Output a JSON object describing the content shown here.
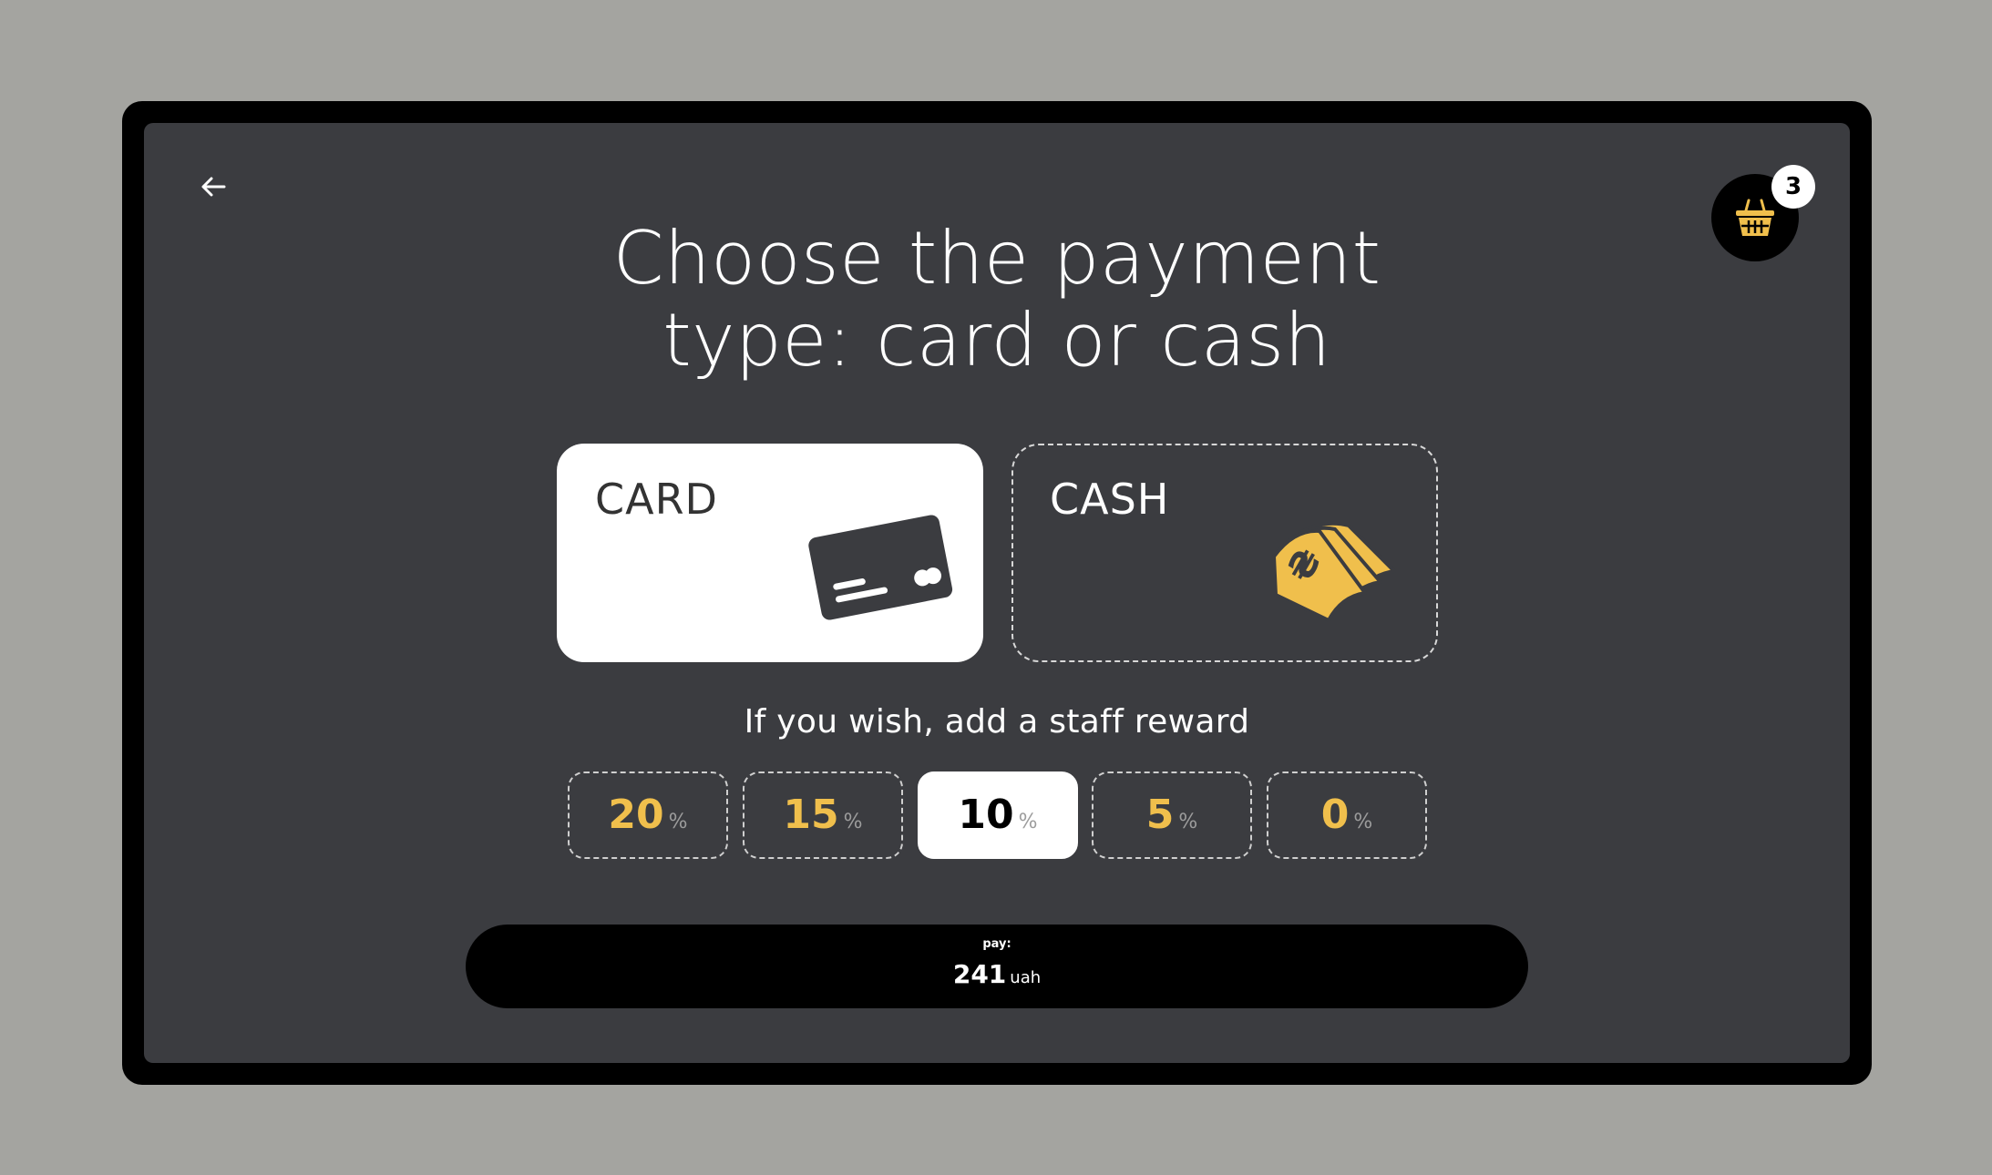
{
  "header": {
    "title_line1": "Choose the payment",
    "title_line2": "type: card or cash",
    "basket_count": "3"
  },
  "payment_options": {
    "card_label": "CARD",
    "cash_label": "CASH",
    "selected": "card"
  },
  "tips": {
    "title": "If you wish, add a staff reward",
    "options": [
      {
        "value": "20",
        "unit": "%"
      },
      {
        "value": "15",
        "unit": "%"
      },
      {
        "value": "10",
        "unit": "%"
      },
      {
        "value": "5",
        "unit": "%"
      },
      {
        "value": "0",
        "unit": "%"
      }
    ],
    "selected_value": "10"
  },
  "pay_bar": {
    "label": "pay:",
    "amount": "241",
    "currency": "uah"
  },
  "colors": {
    "accent": "#f0bf4c",
    "screen_bg": "#3b3c40",
    "device_frame": "#000000",
    "page_bg": "#a4a4a0"
  },
  "icons": [
    "arrow-left-icon",
    "basket-icon",
    "credit-card-icon",
    "cash-bills-icon"
  ]
}
